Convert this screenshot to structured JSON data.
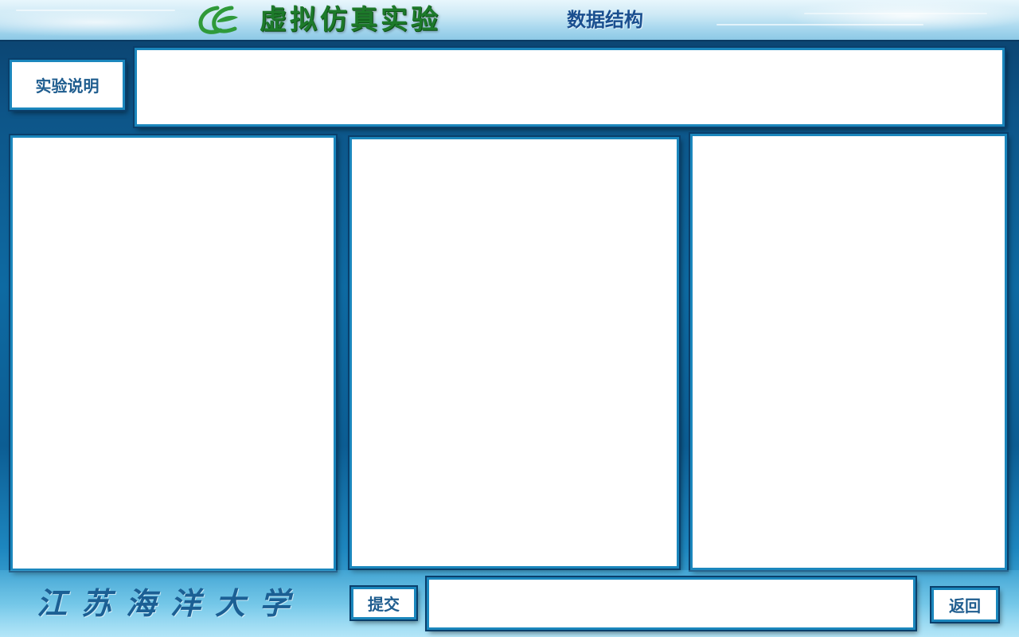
{
  "header": {
    "title": "虚拟仿真实验",
    "subtitle": "数据结构",
    "logo_icon": "e-logo-icon"
  },
  "instructions": {
    "button_label": "实验说明",
    "content": ""
  },
  "panels": {
    "left": "",
    "middle": "",
    "right": ""
  },
  "footer": {
    "school_name": "江苏海洋大学",
    "submit_label": "提交",
    "answer_value": "",
    "back_label": "返回"
  },
  "colors": {
    "accent_border": "#1b87bd",
    "title_green": "#1d7a2a",
    "label_blue": "#1f5d8f"
  }
}
